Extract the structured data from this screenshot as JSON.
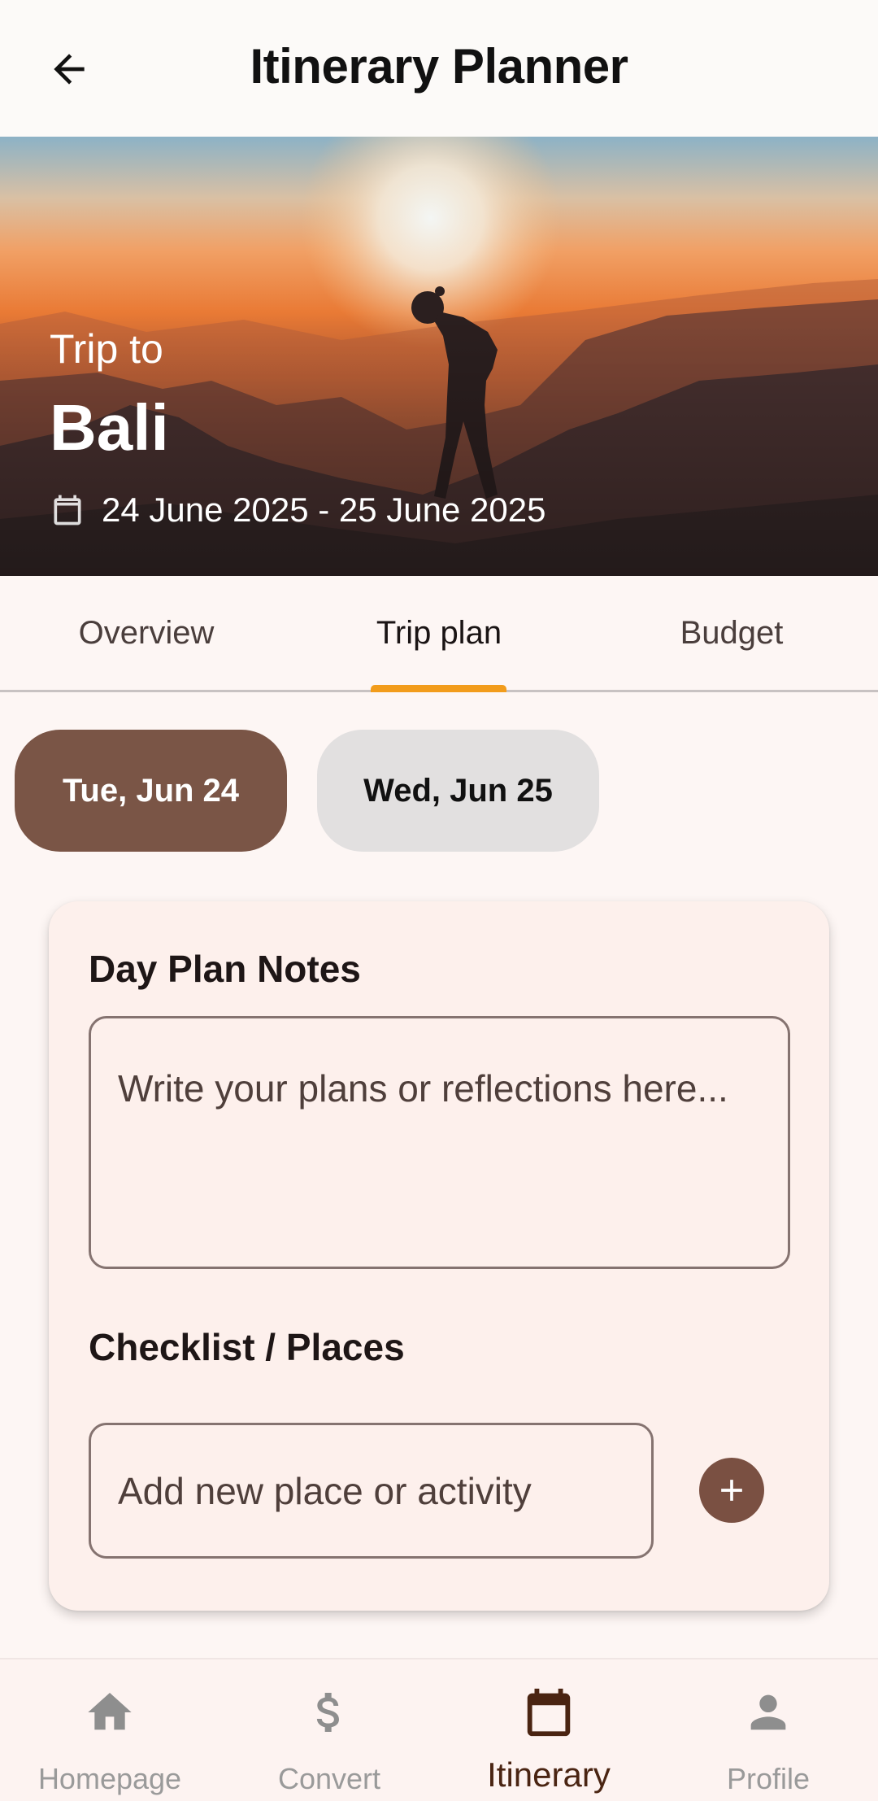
{
  "appbar": {
    "title": "Itinerary Planner",
    "back_icon": "arrow-left-icon"
  },
  "hero": {
    "trip_to": "Trip to",
    "destination": "Bali",
    "dates": "24 June 2025 - 25 June 2025",
    "date_icon": "calendar-icon"
  },
  "tabs": [
    {
      "label": "Overview",
      "active": false
    },
    {
      "label": "Trip plan",
      "active": true
    },
    {
      "label": "Budget",
      "active": false
    }
  ],
  "days": [
    {
      "label": "Tue, Jun 24",
      "selected": true
    },
    {
      "label": "Wed, Jun 25",
      "selected": false
    }
  ],
  "card": {
    "notes_heading": "Day Plan Notes",
    "notes_placeholder": "Write your plans or reflections here...",
    "checklist_heading": "Checklist / Places",
    "place_placeholder": "Add new place or activity",
    "add_icon": "add-circle-icon"
  },
  "bottom_nav": [
    {
      "label": "Homepage",
      "icon": "home-icon",
      "active": false
    },
    {
      "label": "Convert",
      "icon": "dollar-icon",
      "active": false
    },
    {
      "label": "Itinerary",
      "icon": "calendar-icon",
      "active": true
    },
    {
      "label": "Profile",
      "icon": "person-icon",
      "active": false
    }
  ],
  "colors": {
    "accent_brown": "#7a5546",
    "tab_indicator": "#f29c1b",
    "background": "#fdf6f4"
  }
}
